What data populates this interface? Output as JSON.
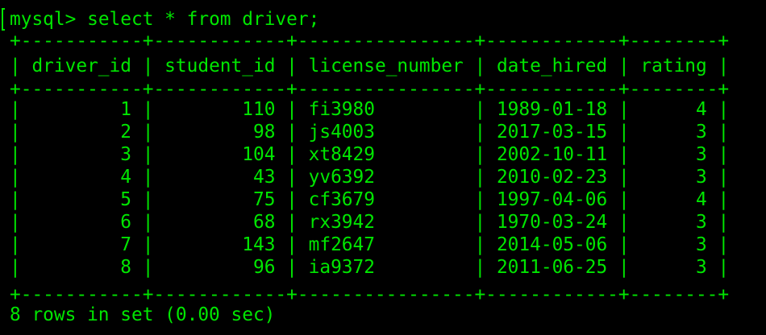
{
  "terminal": {
    "prompt": "mysql>",
    "command": "select * from driver;",
    "text_color": "#00e600",
    "background_color": "#000000"
  },
  "table": {
    "border": "+-----------+------------+----------------+------------+--------+",
    "columns": [
      "driver_id",
      "student_id",
      "license_number",
      "date_hired",
      "rating"
    ],
    "rows": [
      {
        "driver_id": "1",
        "student_id": "110",
        "license_number": "fi3980",
        "date_hired": "1989-01-18",
        "rating": "4"
      },
      {
        "driver_id": "2",
        "student_id": "98",
        "license_number": "js4003",
        "date_hired": "2017-03-15",
        "rating": "3"
      },
      {
        "driver_id": "3",
        "student_id": "104",
        "license_number": "xt8429",
        "date_hired": "2002-10-11",
        "rating": "3"
      },
      {
        "driver_id": "4",
        "student_id": "43",
        "license_number": "yv6392",
        "date_hired": "2010-02-23",
        "rating": "3"
      },
      {
        "driver_id": "5",
        "student_id": "75",
        "license_number": "cf3679",
        "date_hired": "1997-04-06",
        "rating": "4"
      },
      {
        "driver_id": "6",
        "student_id": "68",
        "license_number": "rx3942",
        "date_hired": "1970-03-24",
        "rating": "3"
      },
      {
        "driver_id": "7",
        "student_id": "143",
        "license_number": "mf2647",
        "date_hired": "2014-05-06",
        "rating": "3"
      },
      {
        "driver_id": "8",
        "student_id": "96",
        "license_number": "ia9372",
        "date_hired": "2011-06-25",
        "rating": "3"
      }
    ]
  },
  "summary": "8 rows in set (0.00 sec)"
}
